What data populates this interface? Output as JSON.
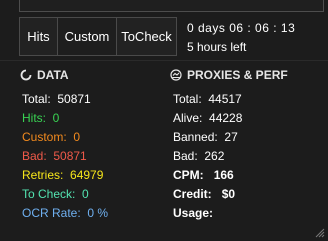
{
  "tabs": [
    {
      "label": "Hits"
    },
    {
      "label": "Custom"
    },
    {
      "label": "ToCheck"
    }
  ],
  "timer": {
    "days_line": "0  days  06 : 06 : 13",
    "remaining": "5 hours left"
  },
  "data_section": {
    "title": "DATA",
    "icon": "circle-refresh-icon",
    "total": {
      "label": "Total:",
      "value": "50871"
    },
    "hits": {
      "label": "Hits:",
      "value": "0"
    },
    "custom": {
      "label": "Custom:",
      "value": "0"
    },
    "bad": {
      "label": "Bad:",
      "value": "50871"
    },
    "retries": {
      "label": "Retries:",
      "value": "64979"
    },
    "tocheck": {
      "label": "To Check:",
      "value": "0"
    },
    "ocr": {
      "label": "OCR Rate:",
      "value": "0 %"
    }
  },
  "proxy_section": {
    "title": "PROXIES & PERF",
    "icon": "globe-icon",
    "total": {
      "label": "Total:",
      "value": "44517"
    },
    "alive": {
      "label": "Alive:",
      "value": "44228"
    },
    "banned": {
      "label": "Banned:",
      "value": "27"
    },
    "bad": {
      "label": "Bad:",
      "value": "262"
    },
    "cpm": {
      "label": "CPM:",
      "value": "166"
    },
    "credit": {
      "label": "Credit:",
      "value": "$0"
    },
    "usage": {
      "label": "Usage:",
      "value": ""
    }
  },
  "colors": {
    "background": "#1c1c1c",
    "green": "#39d353",
    "orange": "#f28a1e",
    "red": "#f05a4a",
    "yellow": "#f6e61a",
    "aqua": "#53e3b0",
    "blue": "#6fb0f0"
  }
}
